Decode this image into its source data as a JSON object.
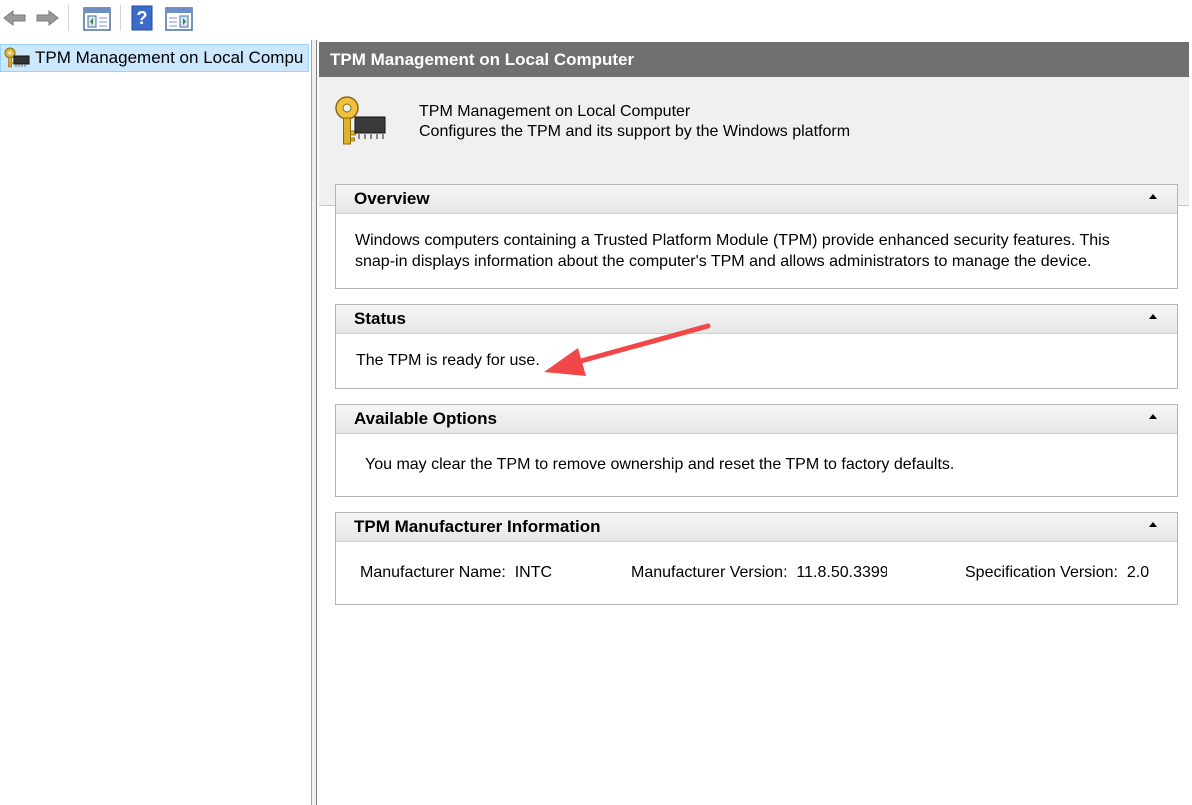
{
  "toolbar": {
    "back_icon": "back-arrow-icon",
    "forward_icon": "forward-arrow-icon",
    "show_hide_tree_icon": "console-tree-icon",
    "help_icon": "help-icon",
    "show_hide_action_icon": "action-pane-icon"
  },
  "tree": {
    "selected_item": "TPM Management on Local Compu"
  },
  "main": {
    "title": "TPM Management on Local Computer",
    "intro_title": "TPM Management on Local Computer",
    "intro_desc": "Configures the TPM and its support by the Windows platform",
    "overview": {
      "heading": "Overview",
      "line1": "Windows computers containing a Trusted Platform Module (TPM) provide enhanced security features. This",
      "line2": "snap-in displays information about the computer's TPM and allows administrators to manage the device."
    },
    "status": {
      "heading": "Status",
      "text": "The TPM is ready for use."
    },
    "options": {
      "heading": "Available Options",
      "text": "You may clear the TPM to remove ownership and reset the TPM to factory defaults."
    },
    "manufacturer": {
      "heading": "TPM Manufacturer Information",
      "name_label": "Manufacturer Name:",
      "name_value": "INTC",
      "version_label": "Manufacturer Version:",
      "version_value": "11.8.50.3399",
      "spec_label": "Specification Version:",
      "spec_value": "2.0"
    }
  },
  "colors": {
    "title_bar": "#707070",
    "selection": "#cce8ff",
    "annotation_arrow": "#f04848"
  }
}
